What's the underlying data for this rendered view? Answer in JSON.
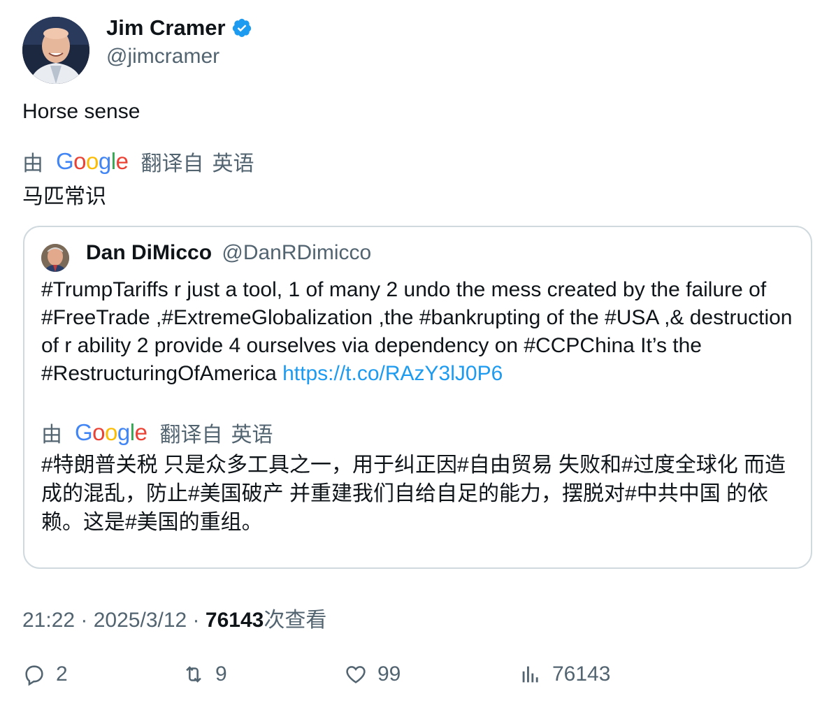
{
  "author": {
    "display_name": "Jim Cramer",
    "handle": "@jimcramer",
    "verified": true
  },
  "tweet": {
    "text": "Horse sense",
    "translation": {
      "by": "由",
      "brand": "Google",
      "from_label": "翻译自",
      "language": "英语",
      "text": "马匹常识"
    }
  },
  "quoted": {
    "display_name": "Dan DiMicco",
    "handle": "@DanRDimicco",
    "text": "#TrumpTariffs r just a tool, 1 of many 2 undo the mess created by the failure of #FreeTrade ,#ExtremeGlobalization ,the #bankrupting of the #USA ,& destruction of r ability 2 provide 4 ourselves via dependency on #CCPChina It’s the #RestructuringOfAmerica ",
    "link": "https://t.co/RAzY3lJ0P6",
    "translation": {
      "by": "由",
      "brand": "Google",
      "from_label": "翻译自",
      "language": "英语",
      "text": "#特朗普关税 只是众多工具之一，用于纠正因#自由贸易 失败和#过度全球化 而造成的混乱，防止#美国破产 并重建我们自给自足的能力，摆脱对#中共中国 的依赖。这是#美国的重组。"
    }
  },
  "meta": {
    "time": "21:22",
    "sep1": " · ",
    "date": "2025/3/12",
    "sep2": " · ",
    "views": "76143",
    "views_label": "次查看"
  },
  "actions": {
    "replies": "2",
    "reposts": "9",
    "likes": "99",
    "views": "76143"
  },
  "colors": {
    "text": "#0f1419",
    "secondary": "#536471",
    "link": "#1d9bf0",
    "border": "#cfd9de",
    "verified": "#1d9bf0"
  }
}
